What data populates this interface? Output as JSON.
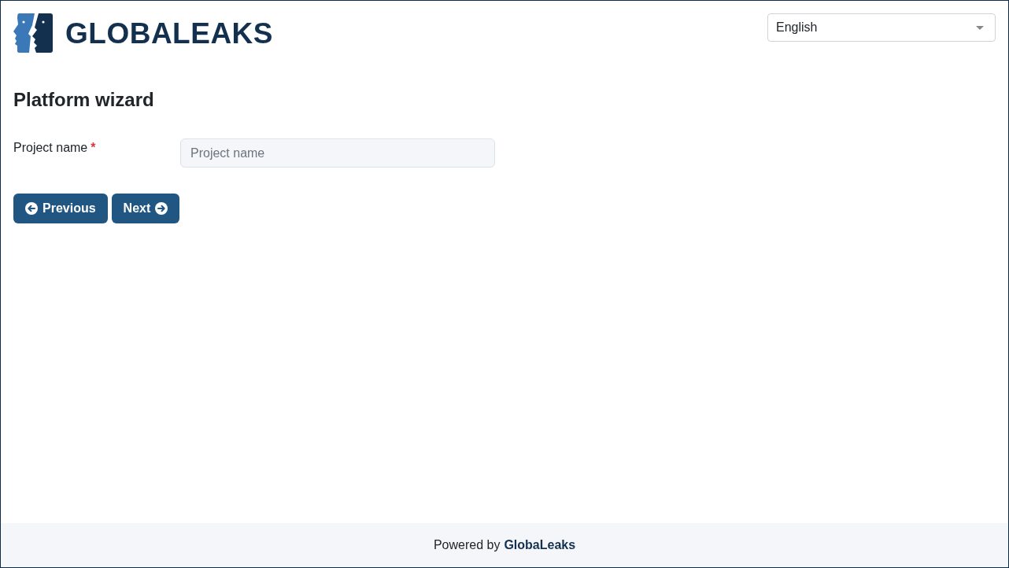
{
  "header": {
    "logo": {
      "text": "GLOBALEAKS"
    },
    "language_select": {
      "value": "English"
    }
  },
  "page": {
    "title": "Platform wizard",
    "fields": [
      {
        "label": "Project name",
        "required": true,
        "required_mark": "*",
        "placeholder": "Project name"
      }
    ],
    "buttons": [
      {
        "label": "Previous",
        "kind": "previous"
      },
      {
        "label": "Next",
        "kind": "next"
      }
    ]
  },
  "footer": {
    "text": "Powered by",
    "link": "GlobaLeaks"
  }
}
